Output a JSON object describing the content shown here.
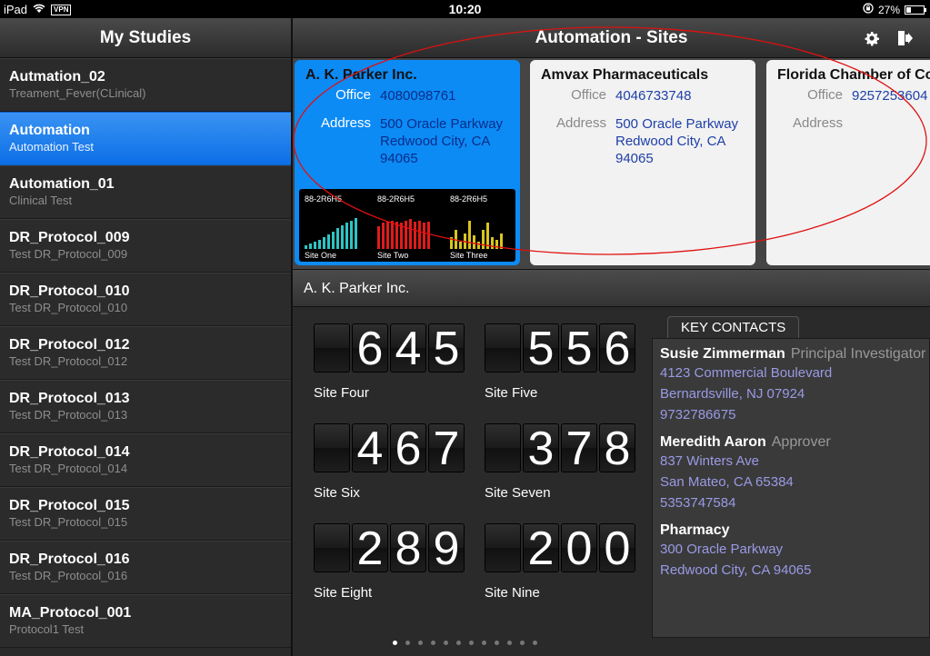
{
  "status": {
    "device": "iPad",
    "vpn": "VPN",
    "time": "10:20",
    "battery": "27%",
    "battery_level": 0.27
  },
  "sidebar": {
    "title": "My Studies",
    "items": [
      {
        "name": "Autmation_02",
        "sub": "Treament_Fever(CLinical)"
      },
      {
        "name": "Automation",
        "sub": "Automation Test",
        "selected": true
      },
      {
        "name": "Automation_01",
        "sub": "Clinical Test"
      },
      {
        "name": "DR_Protocol_009",
        "sub": "Test DR_Protocol_009"
      },
      {
        "name": "DR_Protocol_010",
        "sub": "Test DR_Protocol_010"
      },
      {
        "name": "DR_Protocol_012",
        "sub": "Test DR_Protocol_012"
      },
      {
        "name": "DR_Protocol_013",
        "sub": "Test DR_Protocol_013"
      },
      {
        "name": "DR_Protocol_014",
        "sub": "Test DR_Protocol_014"
      },
      {
        "name": "DR_Protocol_015",
        "sub": "Test DR_Protocol_015"
      },
      {
        "name": "DR_Protocol_016",
        "sub": "Test DR_Protocol_016"
      },
      {
        "name": "MA_Protocol_001",
        "sub": "Protocol1 Test"
      }
    ]
  },
  "main": {
    "title": "Automation - Sites",
    "icons": {
      "settings": "gear-icon",
      "exit": "logout-icon"
    },
    "cards": [
      {
        "name": "A. K. Parker Inc.",
        "office_label": "Office",
        "office": "4080098761",
        "address_label": "Address",
        "address": [
          "500 Oracle Parkway",
          "Redwood City, CA",
          "94065"
        ],
        "active": true,
        "minicharts": [
          {
            "code": "88-2R6H5",
            "site": "Site One",
            "color": "#2ec4c4",
            "values": [
              0.1,
              0.15,
              0.2,
              0.25,
              0.3,
              0.38,
              0.45,
              0.55,
              0.62,
              0.7,
              0.75,
              0.8
            ]
          },
          {
            "code": "88-2R6H5",
            "site": "Site Two",
            "color": "#e11b1b",
            "values": [
              0.6,
              0.7,
              0.72,
              0.75,
              0.72,
              0.7,
              0.75,
              0.78,
              0.72,
              0.75,
              0.7,
              0.72
            ]
          },
          {
            "code": "88-2R6H5",
            "site": "Site Three",
            "color": "#d8c51e",
            "values": [
              0.3,
              0.5,
              0.2,
              0.4,
              0.75,
              0.35,
              0.2,
              0.5,
              0.7,
              0.3,
              0.25,
              0.4
            ]
          }
        ]
      },
      {
        "name": "Amvax Pharmaceuticals",
        "office_label": "Office",
        "office": "4046733748",
        "address_label": "Address",
        "address": [
          "500 Oracle Parkway",
          "Redwood City, CA",
          "94065"
        ],
        "active": false
      },
      {
        "name": "Florida Chamber of Com",
        "office_label": "Office",
        "office": "9257253604",
        "address_label": "Address",
        "address": [],
        "active": false
      }
    ],
    "selected_site": "A. K. Parker Inc.",
    "metrics": [
      {
        "value": "645",
        "label": "Site Four"
      },
      {
        "value": "556",
        "label": "Site Five"
      },
      {
        "value": "467",
        "label": "Site Six"
      },
      {
        "value": "378",
        "label": "Site Seven"
      },
      {
        "value": "289",
        "label": "Site Eight"
      },
      {
        "value": "200",
        "label": "Site Nine"
      }
    ],
    "contacts_tab": "KEY CONTACTS",
    "contacts": [
      {
        "name": "Susie Zimmerman",
        "role": "Principal Investigator",
        "lines": [
          "4123 Commercial Boulevard",
          "Bernardsville, NJ 07924",
          "9732786675"
        ]
      },
      {
        "name": "Meredith Aaron",
        "role": "Approver",
        "lines": [
          "837 Winters Ave",
          "San Mateo, CA 65384",
          "5353747584"
        ]
      },
      {
        "name": "Pharmacy",
        "role": "",
        "lines": [
          "300 Oracle Parkway",
          "Redwood City, CA 94065"
        ]
      }
    ],
    "page_dots": {
      "count": 12,
      "current": 0
    }
  },
  "annotation": {
    "color": "#e01010"
  }
}
